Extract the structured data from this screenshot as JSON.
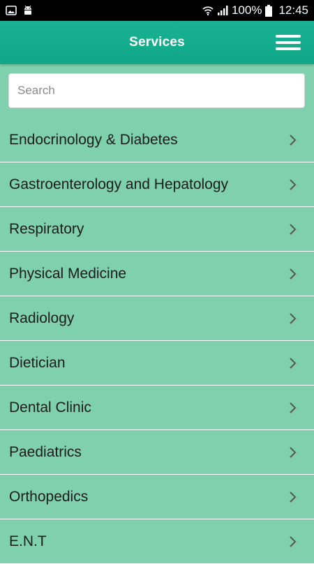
{
  "status_bar": {
    "battery": "100%",
    "time": "12:45",
    "icons": [
      "image-notification-icon",
      "android-notification-icon",
      "wifi-icon",
      "signal-icon",
      "battery-icon"
    ]
  },
  "header": {
    "title": "Services",
    "menu_icon": "hamburger-menu-icon"
  },
  "search": {
    "placeholder": "Search",
    "value": ""
  },
  "services": [
    {
      "label": "Endocrinology & Diabetes"
    },
    {
      "label": "Gastroenterology and Hepatology"
    },
    {
      "label": "Respiratory"
    },
    {
      "label": "Physical Medicine"
    },
    {
      "label": "Radiology"
    },
    {
      "label": "Dietician"
    },
    {
      "label": "Dental Clinic"
    },
    {
      "label": "Paediatrics"
    },
    {
      "label": "Orthopedics"
    },
    {
      "label": "E.N.T"
    }
  ],
  "colors": {
    "app_bar": "#13ad8d",
    "list_background": "#7fd1ad",
    "divider": "#ffffff",
    "status_bar": "#000000"
  }
}
